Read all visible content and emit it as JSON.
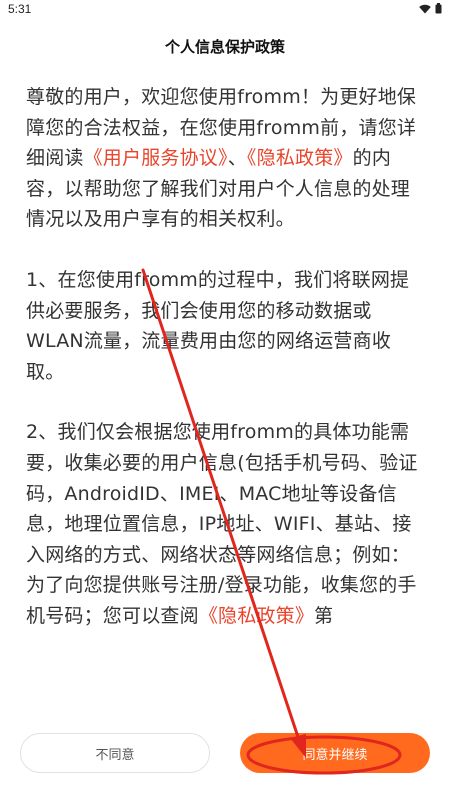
{
  "status_bar": {
    "time": "5:31"
  },
  "header": {
    "title": "个人信息保护政策"
  },
  "content": {
    "p1": {
      "text_a": "尊敬的用户，欢迎您使用fromm！为更好地保障您的合法权益，在您使用fromm前，请您详细阅读",
      "link_1": "《用户服务协议》",
      "sep": "、",
      "link_2": "《隐私政策》",
      "text_b": "的内容，以帮助您了解我们对用户个人信息的处理情况以及用户享有的相关权利。"
    },
    "p2": {
      "text": "1、在您使用fromm的过程中，我们将联网提供必要服务，我们会使用您的移动数据或WLAN流量，流量费用由您的网络运营商收取。"
    },
    "p3": {
      "text_a": "2、我们仅会根据您使用fromm的具体功能需要，收集必要的用户信息(包括手机号码、验证码，AndroidID、IMEI、MAC地址等设备信息，地理位置信息，IP地址、WIFI、基站、接入网络的方式、网络状态等网络信息；例如：为了向您提供账号注册/登录功能，收集您的手机号码；您可以查阅",
      "link": "《隐私政策》",
      "text_b": "第"
    }
  },
  "buttons": {
    "disagree_label": "不同意",
    "agree_label": "同意并继续"
  },
  "colors": {
    "accent": "#ff6a1f",
    "link": "#e8452c",
    "annotation": "#e0261d"
  }
}
